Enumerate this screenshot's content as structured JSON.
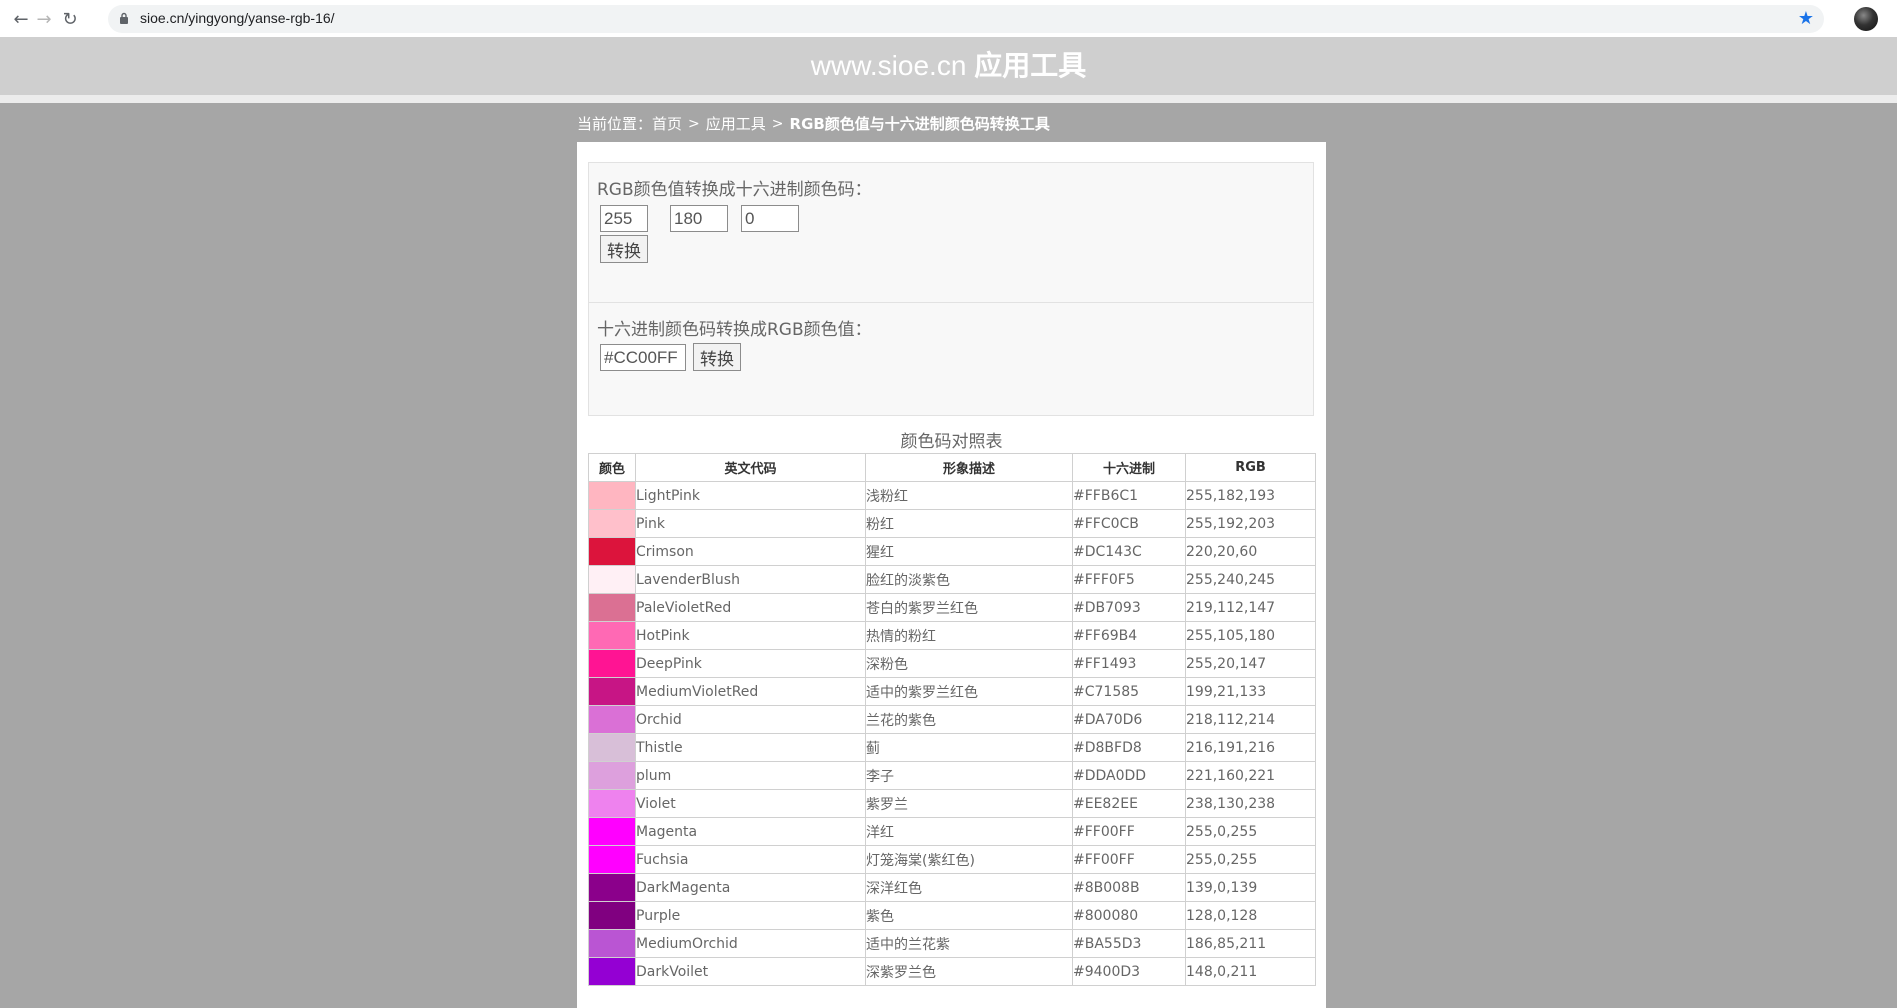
{
  "browser": {
    "url": "sioe.cn/yingyong/yanse-rgb-16/",
    "colors": {
      "bookmark_star": "#1a73e8"
    }
  },
  "site": {
    "title_prefix": "www.sioe.cn",
    "title_suffix": "应用工具"
  },
  "breadcrumb": {
    "prefix": "当前位置：",
    "home": "首页",
    "section": "应用工具",
    "current": "RGB颜色值与十六进制颜色码转换工具",
    "separator": ">"
  },
  "rgb_to_hex": {
    "label": "RGB颜色值转换成十六进制颜色码：",
    "r": "255",
    "g": "180",
    "b": "0",
    "button": "转换"
  },
  "hex_to_rgb": {
    "label": "十六进制颜色码转换成RGB颜色值：",
    "hex": "#CC00FF",
    "button": "转换"
  },
  "color_table": {
    "caption": "颜色码对照表",
    "headers": [
      "颜色",
      "英文代码",
      "形象描述",
      "十六进制",
      "RGB"
    ],
    "rows": [
      {
        "name": "LightPink",
        "desc": "浅粉红",
        "hex": "#FFB6C1",
        "rgb": "255,182,193",
        "swatch": "#FFB6C1"
      },
      {
        "name": "Pink",
        "desc": "粉红",
        "hex": "#FFC0CB",
        "rgb": "255,192,203",
        "swatch": "#FFC0CB"
      },
      {
        "name": "Crimson",
        "desc": "猩红",
        "hex": "#DC143C",
        "rgb": "220,20,60",
        "swatch": "#DC143C"
      },
      {
        "name": "LavenderBlush",
        "desc": "脸红的淡紫色",
        "hex": "#FFF0F5",
        "rgb": "255,240,245",
        "swatch": "#FFF0F5"
      },
      {
        "name": "PaleVioletRed",
        "desc": "苍白的紫罗兰红色",
        "hex": "#DB7093",
        "rgb": "219,112,147",
        "swatch": "#DB7093"
      },
      {
        "name": "HotPink",
        "desc": "热情的粉红",
        "hex": "#FF69B4",
        "rgb": "255,105,180",
        "swatch": "#FF69B4"
      },
      {
        "name": "DeepPink",
        "desc": "深粉色",
        "hex": "#FF1493",
        "rgb": "255,20,147",
        "swatch": "#FF1493"
      },
      {
        "name": "MediumVioletRed",
        "desc": "适中的紫罗兰红色",
        "hex": "#C71585",
        "rgb": "199,21,133",
        "swatch": "#C71585"
      },
      {
        "name": "Orchid",
        "desc": "兰花的紫色",
        "hex": "#DA70D6",
        "rgb": "218,112,214",
        "swatch": "#DA70D6"
      },
      {
        "name": "Thistle",
        "desc": "蓟",
        "hex": "#D8BFD8",
        "rgb": "216,191,216",
        "swatch": "#D8BFD8"
      },
      {
        "name": "plum",
        "desc": "李子",
        "hex": "#DDA0DD",
        "rgb": "221,160,221",
        "swatch": "#DDA0DD"
      },
      {
        "name": "Violet",
        "desc": "紫罗兰",
        "hex": "#EE82EE",
        "rgb": "238,130,238",
        "swatch": "#EE82EE"
      },
      {
        "name": "Magenta",
        "desc": "洋红",
        "hex": "#FF00FF",
        "rgb": "255,0,255",
        "swatch": "#FF00FF"
      },
      {
        "name": "Fuchsia",
        "desc": "灯笼海棠(紫红色)",
        "hex": "#FF00FF",
        "rgb": "255,0,255",
        "swatch": "#FF00FF"
      },
      {
        "name": "DarkMagenta",
        "desc": "深洋红色",
        "hex": "#8B008B",
        "rgb": "139,0,139",
        "swatch": "#8B008B"
      },
      {
        "name": "Purple",
        "desc": "紫色",
        "hex": "#800080",
        "rgb": "128,0,128",
        "swatch": "#800080"
      },
      {
        "name": "MediumOrchid",
        "desc": "适中的兰花紫",
        "hex": "#BA55D3",
        "rgb": "186,85,211",
        "swatch": "#BA55D3"
      },
      {
        "name": "DarkVoilet",
        "desc": "深紫罗兰色",
        "hex": "#9400D3",
        "rgb": "148,0,211",
        "swatch": "#9400D3"
      }
    ]
  }
}
